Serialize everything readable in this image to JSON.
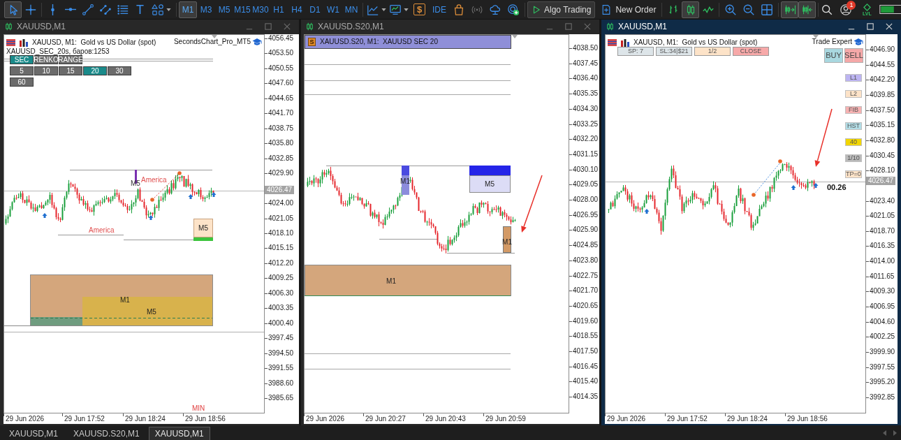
{
  "toolbar": {
    "tools": [
      {
        "kind": "cursor",
        "selected": true
      },
      {
        "kind": "crosshair",
        "selected": false
      },
      {
        "kind": "vline",
        "selected": false
      },
      {
        "kind": "hline",
        "selected": false
      },
      {
        "kind": "trendline",
        "selected": false
      },
      {
        "kind": "channel",
        "selected": false
      },
      {
        "kind": "fibo",
        "selected": false
      },
      {
        "kind": "text",
        "glyph": "T",
        "selected": false
      },
      {
        "kind": "shapes",
        "selected": false
      }
    ],
    "timeframes": [
      {
        "label": "M1",
        "selected": true
      },
      {
        "label": "M3",
        "selected": false
      },
      {
        "label": "M5",
        "selected": false
      },
      {
        "label": "M15",
        "selected": false
      },
      {
        "label": "M30",
        "selected": false
      },
      {
        "label": "H1",
        "selected": false
      },
      {
        "label": "H4",
        "selected": false
      },
      {
        "label": "D1",
        "selected": false
      },
      {
        "label": "W1",
        "selected": false
      },
      {
        "label": "MN",
        "selected": false
      }
    ],
    "market": "$",
    "ide": "IDE",
    "algo_trading": "Algo Trading",
    "new_order": "New Order",
    "chart_types": [
      {
        "kind": "bars",
        "selected": false
      },
      {
        "kind": "candles",
        "selected": true
      },
      {
        "kind": "line",
        "selected": false
      }
    ],
    "chart_toggles": [
      {
        "kind": "autoscroll",
        "on": true
      },
      {
        "kind": "shift",
        "on": true
      }
    ],
    "notifications": "1",
    "level_label": "LVL"
  },
  "windows": [
    {
      "title": "XAUUSD,M1",
      "active": false,
      "chart": {
        "kind": "seconds",
        "header": "XAUUSD, M1:  Gold vs US Dollar (spot)",
        "expert": "SecondsChart_Pro_MT5",
        "info": "XAUUSD_SEC_20s, баров:1253",
        "modes": [
          {
            "label": "SEC",
            "selected": true
          },
          {
            "label": "RENKO",
            "selected": false
          },
          {
            "label": "RANGE",
            "selected": false
          }
        ],
        "periods": [
          {
            "label": "5",
            "selected": false
          },
          {
            "label": "10",
            "selected": false
          },
          {
            "label": "15",
            "selected": false
          },
          {
            "label": "20",
            "selected": true
          },
          {
            "label": "30",
            "selected": false
          },
          {
            "label": "60",
            "selected": false
          }
        ],
        "labels": [
          "America",
          "America",
          "M5",
          "M5",
          "M1",
          "M5",
          "MIN"
        ],
        "price_axis": [
          "4056.45",
          "4053.50",
          "4050.55",
          "4047.60",
          "4044.65",
          "4041.70",
          "4038.75",
          "4035.80",
          "4032.85",
          "4029.90",
          "4024.00",
          "4021.05",
          "4018.10",
          "4015.15",
          "4012.20",
          "4009.25",
          "4006.30",
          "4003.35",
          "4000.40",
          "3997.45",
          "3994.50",
          "3991.55",
          "3988.60",
          "3985.65"
        ],
        "current_price": "4026.47",
        "time_axis": [
          "29 Jun 2026",
          "29 Jun 17:52",
          "29 Jun 18:24",
          "29 Jun 18:56"
        ]
      }
    },
    {
      "title": "XAUUSD.S20,M1",
      "active": false,
      "chart": {
        "kind": "custom",
        "header_badge": "S",
        "header": "XAUUSD.S20, M1:  XAUUSD SEC 20",
        "labels": [
          "M1",
          "M5",
          "M1",
          "M1"
        ],
        "price_axis": [
          "4038.50",
          "4037.45",
          "4036.40",
          "4035.35",
          "4034.30",
          "4033.25",
          "4032.20",
          "4031.15",
          "4030.10",
          "4029.05",
          "4028.00",
          "4026.95",
          "4025.90",
          "4024.85",
          "4023.80",
          "4022.75",
          "4021.70",
          "4020.65",
          "4019.60",
          "4018.55",
          "4017.50",
          "4016.45",
          "4015.40",
          "4014.35"
        ],
        "time_axis": [
          "29 Jun 2026",
          "29 Jun 20:27",
          "29 Jun 20:43",
          "29 Jun 20:59"
        ]
      }
    },
    {
      "title": "XAUUSD,M1",
      "active": true,
      "chart": {
        "kind": "trade",
        "header": "XAUUSD, M1:  Gold vs US Dollar (spot)",
        "expert": "Trade Expert",
        "panel_buttons": [
          {
            "label": "SP: 7",
            "color": "#dde5e9"
          },
          {
            "label": "SL:34|$21",
            "color": "#dde5e9"
          },
          {
            "label": "1/2",
            "color": "#fde3c8"
          },
          {
            "label": "CLOSE",
            "color": "#f7a9a9"
          }
        ],
        "trade_buttons": [
          {
            "label": "BUY",
            "color": "#a9d8e0"
          },
          {
            "label": "SELL",
            "color": "#f5a8a8"
          }
        ],
        "side_buttons": [
          {
            "label": "L1",
            "color": "#bcb4f2"
          },
          {
            "label": "L2",
            "color": "#fde3c8"
          },
          {
            "label": "FIB",
            "color": "#f6b2b2"
          },
          {
            "label": "HST",
            "color": "#b2dde6"
          },
          {
            "label": "40",
            "color": "#f2d600"
          },
          {
            "label": "1/10",
            "color": "#bababa"
          },
          {
            "label": "TP=0",
            "color": "#fde3c8"
          }
        ],
        "countdown": "00.26",
        "price_axis": [
          "4046.90",
          "4044.55",
          "4042.20",
          "4039.85",
          "4037.50",
          "4035.15",
          "4032.80",
          "4030.45",
          "4028.10",
          "4023.40",
          "4021.05",
          "4018.70",
          "4016.35",
          "4014.00",
          "4011.65",
          "4009.30",
          "4006.95",
          "4004.60",
          "4002.25",
          "3999.90",
          "3997.55",
          "3995.20",
          "3992.85"
        ],
        "current_price": "4026.47",
        "time_axis": [
          "29 Jun 2026",
          "29 Jun 17:52",
          "29 Jun 18:24",
          "29 Jun 18:56"
        ]
      }
    }
  ],
  "tabs": [
    {
      "label": "XAUUSD,M1",
      "selected": false
    },
    {
      "label": "XAUUSD.S20,M1",
      "selected": false
    },
    {
      "label": "XAUUSD,M1",
      "selected": true
    }
  ]
}
